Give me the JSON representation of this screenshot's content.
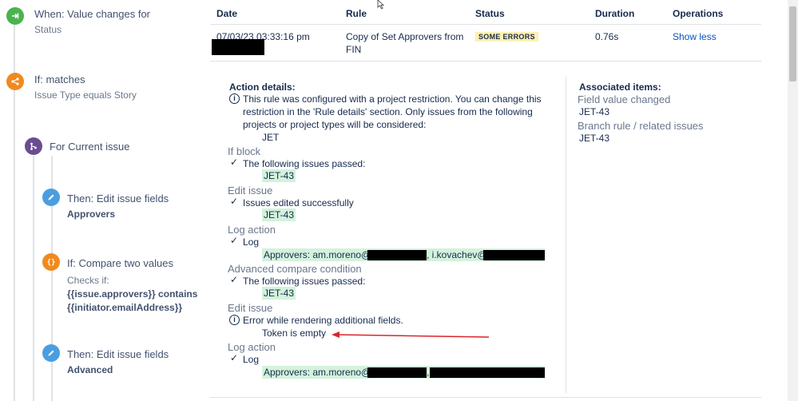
{
  "tree": {
    "trigger": {
      "title": "When: Value changes for",
      "sub": "Status"
    },
    "condition": {
      "title": "If: matches",
      "sub": "Issue Type equals Story"
    },
    "branch": {
      "title": "For Current issue"
    },
    "edit1": {
      "title": "Then: Edit issue fields",
      "bold": "Approvers"
    },
    "compare": {
      "title": "If: Compare two values",
      "sub": "Checks if:",
      "bold1": "{{issue.approvers}} contains",
      "bold2": "{{initiator.emailAddress}}"
    },
    "edit2": {
      "title": "Then: Edit issue fields",
      "bold": "Advanced"
    }
  },
  "table": {
    "headers": {
      "date": "Date",
      "rule": "Rule",
      "status": "Status",
      "duration": "Duration",
      "operations": "Operations"
    },
    "row": {
      "date": "07/03/23 03:33:16 pm",
      "rule_line1": "Copy of Set Approvers from",
      "rule_line2": "FIN",
      "status": "SOME ERRORS",
      "duration": "0.76s",
      "operation": "Show less"
    }
  },
  "details": {
    "heading": "Action details:",
    "restriction_line1": "This rule was configured with a project restriction. You can change this",
    "restriction_line2": "restriction in the 'Rule details' section. Only issues from the following",
    "restriction_line3": "projects or project types will be considered:",
    "project": "JET",
    "if_block": {
      "title": "If block",
      "text": "The following issues passed:",
      "issue": "JET-43"
    },
    "edit_issue_1": {
      "title": "Edit issue",
      "text": "Issues edited successfully",
      "issue": "JET-43"
    },
    "log_action_1": {
      "title": "Log action",
      "text": "Log",
      "approvers": "Approvers: am.moreno@",
      "sep": ", i.kovachev@"
    },
    "advanced_compare": {
      "title": "Advanced compare condition",
      "text": "The following issues passed:",
      "issue": "JET-43"
    },
    "edit_issue_2": {
      "title": "Edit issue",
      "error": "Error while rendering additional fields.",
      "token": "Token is empty"
    },
    "log_action_2": {
      "title": "Log action",
      "text": "Log",
      "approvers": "Approvers: am.moreno@",
      "sep": ","
    }
  },
  "associated": {
    "heading": "Associated items:",
    "field_label": "Field value changed",
    "field_issue": "JET-43",
    "branch_label": "Branch rule / related issues",
    "branch_issue": "JET-43"
  },
  "colors": {
    "trigger": "#4ab34f",
    "condition": "#f08a1f",
    "branch": "#6a4c93",
    "action": "#4a9ee0",
    "highlight": "#d3f2dc",
    "badge": "#fff0b3",
    "link": "#0052cc",
    "arrow": "#d9262b"
  },
  "icons": {
    "trigger": "trigger-icon",
    "condition": "condition-icon",
    "branch": "branch-icon",
    "edit": "pencil-icon",
    "compare": "braces-icon",
    "info": "info-icon",
    "check": "check-icon"
  }
}
